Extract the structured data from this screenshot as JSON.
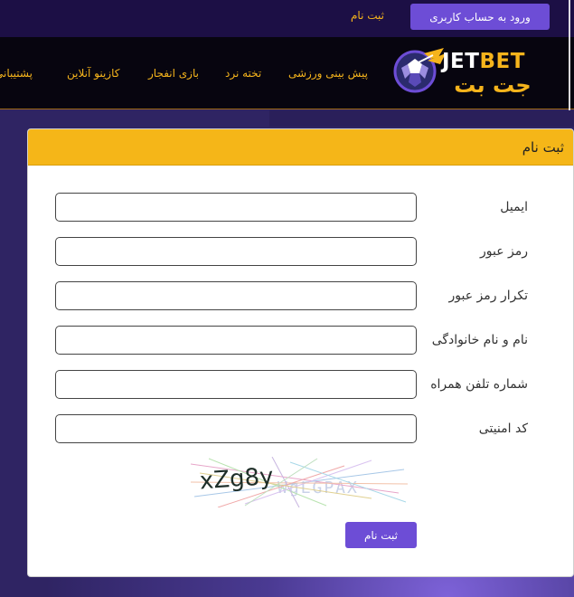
{
  "topbar": {
    "login_label": "ورود به حساب کاربری",
    "register_label": "ثبت نام"
  },
  "logo": {
    "latin_jet": "JET",
    "latin_bet": "BET",
    "persian": "جت بت"
  },
  "nav": {
    "items": [
      {
        "label": "پیش بینی ورزشی"
      },
      {
        "label": "تخته نرد"
      },
      {
        "label": "بازی انفجار"
      },
      {
        "label": "کازینو آنلاین"
      },
      {
        "label": "پشتیبانی"
      }
    ]
  },
  "form": {
    "title": "ثبت نام",
    "fields": [
      {
        "label": "ایمیل",
        "value": "",
        "placeholder": ""
      },
      {
        "label": "رمز عبور",
        "value": "",
        "placeholder": ""
      },
      {
        "label": "تکرار رمز عبور",
        "value": "",
        "placeholder": ""
      },
      {
        "label": "نام و نام خانوادگی",
        "value": "",
        "placeholder": ""
      },
      {
        "label": "شماره تلفن همراه",
        "value": "",
        "placeholder": ""
      },
      {
        "label": "کد امنیتی",
        "value": "",
        "placeholder": ""
      }
    ],
    "captcha_text": "xZg8y",
    "captcha_noise_text": "WgLGPAX",
    "submit_label": "ثبت نام"
  },
  "colors": {
    "accent_purple": "#6d4dd6",
    "accent_gold": "#f5b618",
    "navbar_bg": "#07050f",
    "topbar_bg": "#1c0f45"
  }
}
